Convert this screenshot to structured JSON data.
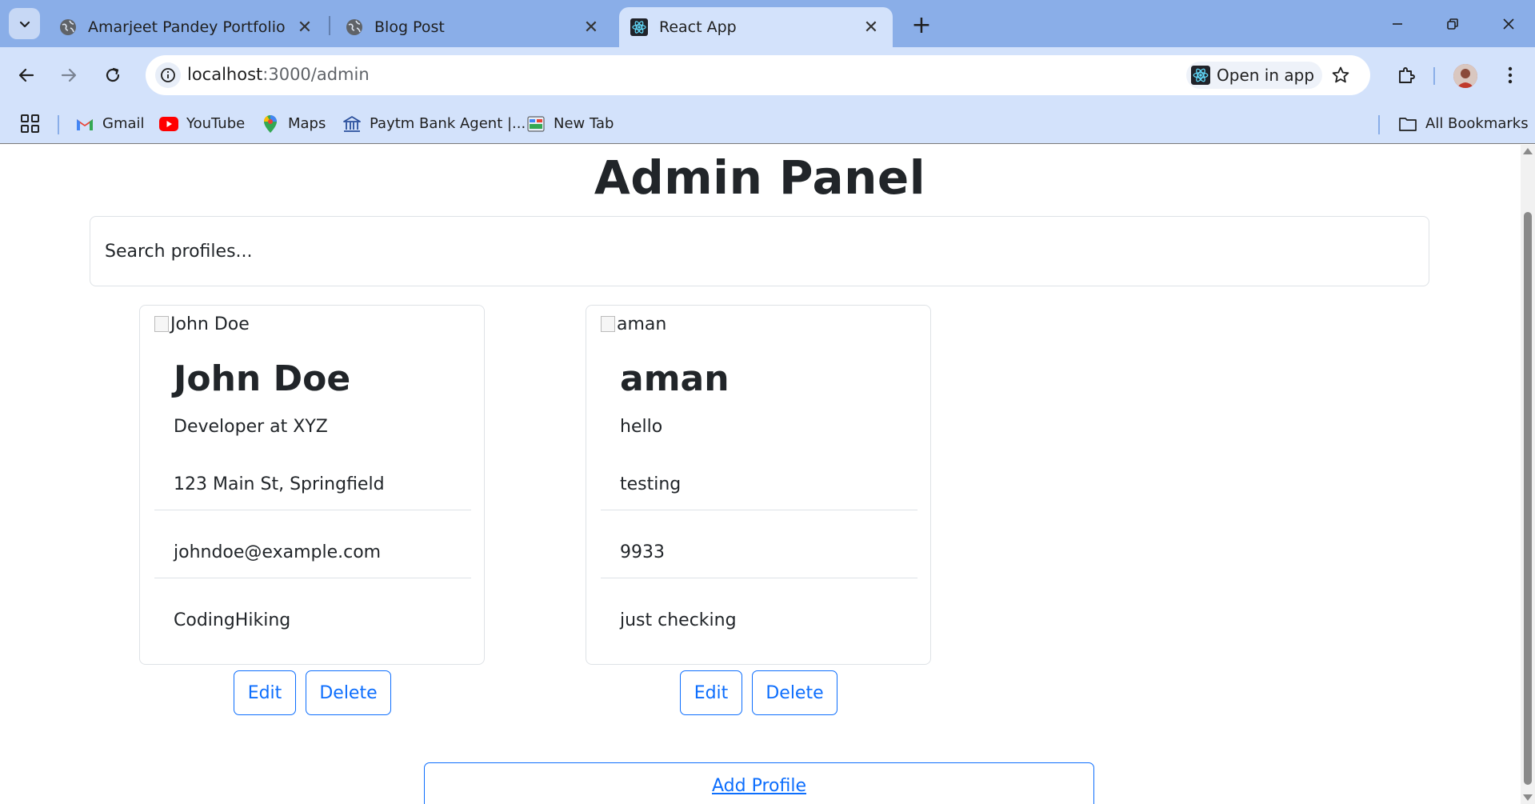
{
  "browser": {
    "tabs": [
      {
        "title": "Amarjeet Pandey Portfolio",
        "icon": "globe-icon"
      },
      {
        "title": "Blog Post",
        "icon": "globe-icon"
      },
      {
        "title": "React App",
        "icon": "react-logo-icon",
        "active": true
      }
    ],
    "url_host": "localhost",
    "url_path": ":3000/admin",
    "open_in_app_label": "Open in app",
    "bookmarks": [
      {
        "label": "Gmail",
        "icon": "gmail-icon"
      },
      {
        "label": "YouTube",
        "icon": "youtube-icon"
      },
      {
        "label": "Maps",
        "icon": "maps-icon"
      },
      {
        "label": "Paytm Bank Agent |...",
        "icon": "bank-icon"
      },
      {
        "label": "New Tab",
        "icon": "newtab-icon"
      }
    ],
    "all_bookmarks_label": "All Bookmarks",
    "colors": {
      "tabstrip": "#8aaee8",
      "toolbar": "#d3e2fb",
      "accent": "#0d6efd"
    }
  },
  "page": {
    "title": "Admin Panel",
    "search_placeholder": "Search profiles...",
    "profiles": [
      {
        "image_alt": "John Doe",
        "name": "John Doe",
        "headline": "Developer at XYZ",
        "address": "123 Main St, Springfield",
        "contact": "johndoe@example.com",
        "interests": "CodingHiking"
      },
      {
        "image_alt": "aman",
        "name": "aman",
        "headline": "hello",
        "address": "testing",
        "contact": "9933",
        "interests": "just checking"
      }
    ],
    "edit_label": "Edit",
    "delete_label": "Delete",
    "add_profile_label": "Add Profile"
  }
}
